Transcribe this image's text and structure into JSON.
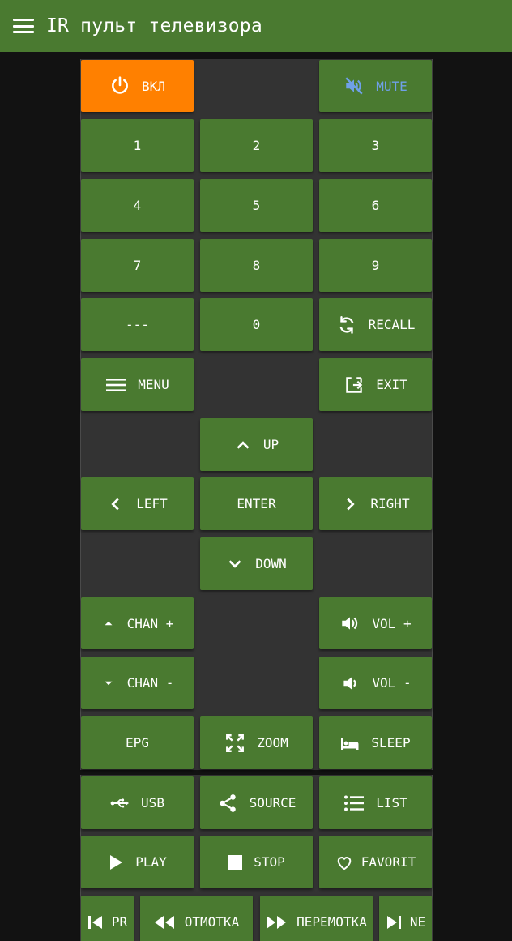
{
  "app": {
    "title": "IR пульт телевизора"
  },
  "colors": {
    "accent": "#4a7a30",
    "power": "#ff8000",
    "mute_text": "#6fa0e8",
    "panel": "#333333",
    "background": "#121212"
  },
  "buttons": {
    "power": {
      "label": "ВКЛ",
      "icon": "power-icon"
    },
    "mute": {
      "label": "MUTE",
      "icon": "volume-off-icon"
    },
    "n1": {
      "label": "1"
    },
    "n2": {
      "label": "2"
    },
    "n3": {
      "label": "3"
    },
    "n4": {
      "label": "4"
    },
    "n5": {
      "label": "5"
    },
    "n6": {
      "label": "6"
    },
    "n7": {
      "label": "7"
    },
    "n8": {
      "label": "8"
    },
    "n9": {
      "label": "9"
    },
    "dash": {
      "label": "---"
    },
    "n0": {
      "label": "0"
    },
    "recall": {
      "label": "RECALL",
      "icon": "sync-icon"
    },
    "menu": {
      "label": "MENU",
      "icon": "menu-icon"
    },
    "exit": {
      "label": "EXIT",
      "icon": "exit-icon"
    },
    "up": {
      "label": "UP",
      "icon": "chevron-up-icon"
    },
    "left": {
      "label": "LEFT",
      "icon": "chevron-left-icon"
    },
    "enter": {
      "label": "ENTER"
    },
    "right": {
      "label": "RIGHT",
      "icon": "chevron-right-icon"
    },
    "down": {
      "label": "DOWN",
      "icon": "chevron-down-icon"
    },
    "chan_up": {
      "label": "CHAN +",
      "icon": "caret-up-icon"
    },
    "vol_up": {
      "label": "VOL +",
      "icon": "volume-up-icon"
    },
    "chan_down": {
      "label": "CHAN -",
      "icon": "caret-down-icon"
    },
    "vol_down": {
      "label": "VOL -",
      "icon": "volume-down-icon"
    },
    "epg": {
      "label": "EPG"
    },
    "zoom": {
      "label": "ZOOM",
      "icon": "fullscreen-icon"
    },
    "sleep": {
      "label": "SLEEP",
      "icon": "bed-icon"
    },
    "usb": {
      "label": "USB",
      "icon": "usb-icon"
    },
    "source": {
      "label": "SOURCE",
      "icon": "share-icon"
    },
    "list": {
      "label": "LIST",
      "icon": "list-icon"
    },
    "play": {
      "label": "PLAY",
      "icon": "play-icon"
    },
    "stop": {
      "label": "STOP",
      "icon": "stop-icon"
    },
    "favorit": {
      "label": "FAVORIT",
      "icon": "heart-icon"
    },
    "prev": {
      "label": "PR",
      "icon": "skip-previous-icon"
    },
    "rewind": {
      "label": "ОТМОТКА",
      "icon": "rewind-icon"
    },
    "forward": {
      "label": "ПЕРЕМОТКА",
      "icon": "fast-forward-icon"
    },
    "next": {
      "label": "NE",
      "icon": "skip-next-icon"
    }
  }
}
